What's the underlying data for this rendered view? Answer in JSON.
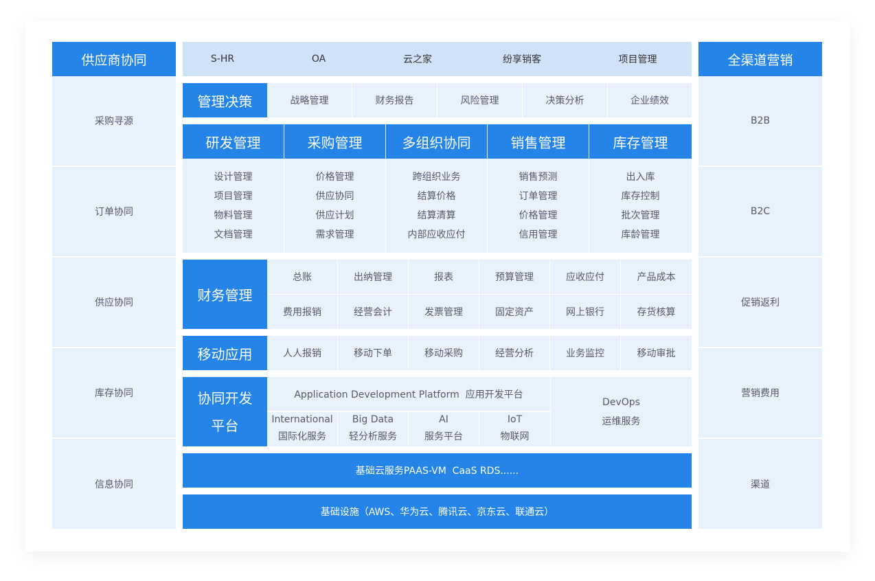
{
  "left": {
    "title": "供应商协同",
    "items": [
      "采购寻源",
      "订单协同",
      "供应协同",
      "库存协同",
      "信息协同"
    ]
  },
  "right": {
    "title": "全渠道营销",
    "items": [
      "B2B",
      "B2C",
      "促销返利",
      "营销费用",
      "渠道"
    ]
  },
  "top_bar": [
    "S-HR",
    "OA",
    "云之家",
    "纷享销客",
    "项目管理"
  ],
  "decision": {
    "title": "管理决策",
    "items": [
      "战略管理",
      "财务报告",
      "风险管理",
      "决策分析",
      "企业绩效"
    ]
  },
  "modules": [
    {
      "title": "研发管理",
      "items": [
        "设计管理",
        "项目管理",
        "物料管理",
        "文档管理"
      ]
    },
    {
      "title": "采购管理",
      "items": [
        "价格管理",
        "供应协同",
        "供应计划",
        "需求管理"
      ]
    },
    {
      "title": "多组织协同",
      "items": [
        "跨组织业务",
        "结算价格",
        "结算清算",
        "内部应收应付"
      ]
    },
    {
      "title": "销售管理",
      "items": [
        "销售预测",
        "订单管理",
        "价格管理",
        "信用管理"
      ]
    },
    {
      "title": "库存管理",
      "items": [
        "出入库",
        "库存控制",
        "批次管理",
        "库龄管理"
      ]
    }
  ],
  "finance": {
    "title": "财务管理",
    "row1": [
      "总账",
      "出纳管理",
      "报表",
      "预算管理",
      "应收应付",
      "产品成本"
    ],
    "row2": [
      "费用报销",
      "经营会计",
      "发票管理",
      "固定资产",
      "网上银行",
      "存货核算"
    ]
  },
  "mobile": {
    "title": "移动应用",
    "items": [
      "人人报销",
      "移动下单",
      "移动采购",
      "经营分析",
      "业务监控",
      "移动审批"
    ]
  },
  "devplatform": {
    "title_line1": "协同开发",
    "title_line2": "平台",
    "adp": "Application Development Platform  应用开发平台",
    "subs": [
      {
        "en": "International",
        "cn": "国际化服务"
      },
      {
        "en": "Big Data",
        "cn": "轻分析服务"
      },
      {
        "en": "AI",
        "cn": "服务平台"
      },
      {
        "en": "IoT",
        "cn": "物联网"
      }
    ],
    "devops_en": "DevOps",
    "devops_cn": "运维服务"
  },
  "cloud_service": "基础云服务PAAS-VM  CaaS RDS......",
  "infrastructure": "基础设施（AWS、华为云、腾讯云、京东云、联通云）",
  "colors": {
    "primary": "#2584e8",
    "light": "#e8f2fc",
    "topbar": "#cfe2f8"
  }
}
